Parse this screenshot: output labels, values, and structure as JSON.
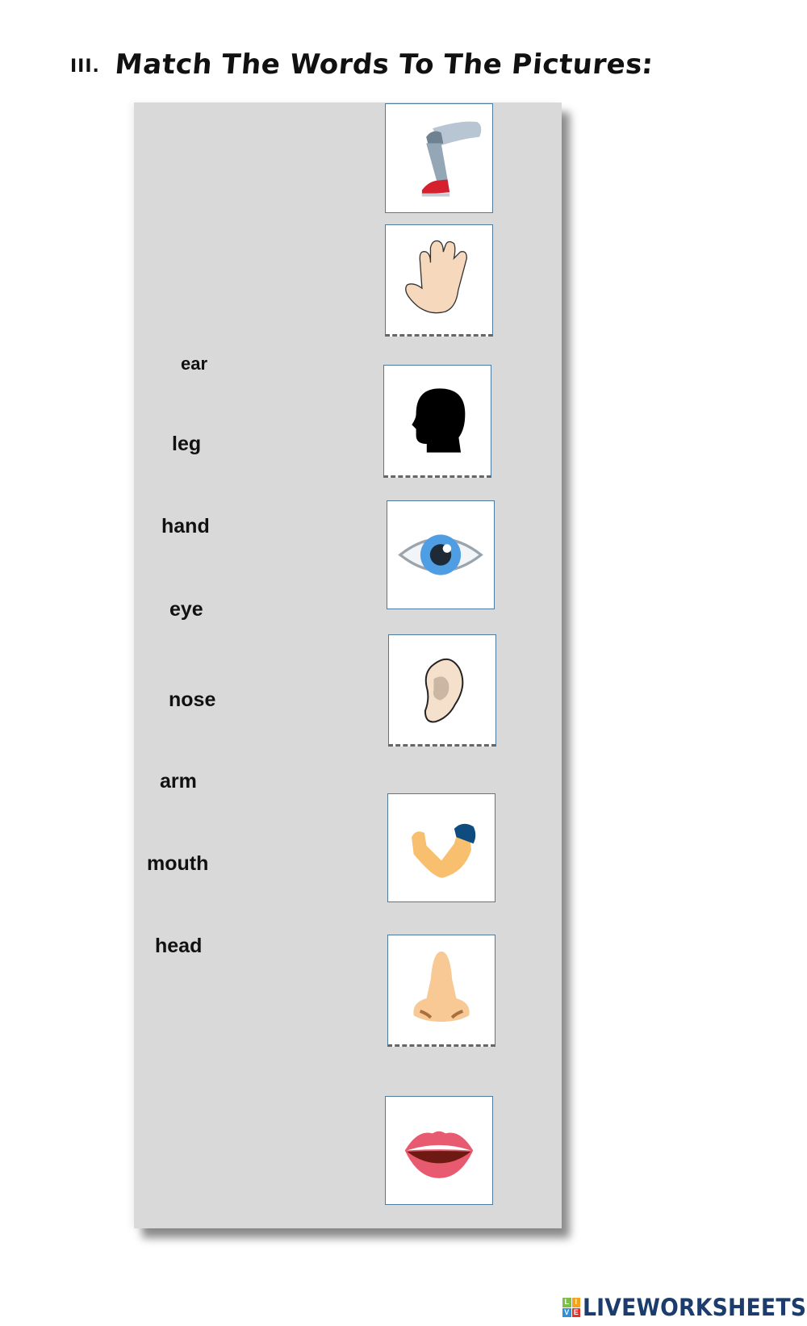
{
  "header": {
    "section_number": "III.",
    "title": "Match The Words To The Pictures:"
  },
  "words": [
    "ear",
    "leg",
    "hand",
    "eye",
    "nose",
    "arm",
    "mouth",
    "head"
  ],
  "pictures": [
    {
      "icon": "leg-picture",
      "alt": "leg"
    },
    {
      "icon": "hand-picture",
      "alt": "hand"
    },
    {
      "icon": "head-picture",
      "alt": "head"
    },
    {
      "icon": "eye-picture",
      "alt": "eye"
    },
    {
      "icon": "ear-picture",
      "alt": "ear"
    },
    {
      "icon": "arm-picture",
      "alt": "arm"
    },
    {
      "icon": "nose-picture",
      "alt": "nose"
    },
    {
      "icon": "mouth-picture",
      "alt": "mouth"
    }
  ],
  "colors": {
    "panel": "#d9d9d9",
    "picture_border": "#4e7a9e",
    "logo_text": "#1d3c6e",
    "logo_tiles": [
      "#7cc242",
      "#f7a21b",
      "#2f8fd8",
      "#e4322b"
    ]
  },
  "footer": {
    "logo_letters": [
      "L",
      "I",
      "V",
      "E"
    ],
    "logo_text": "LIVEWORKSHEETS"
  }
}
